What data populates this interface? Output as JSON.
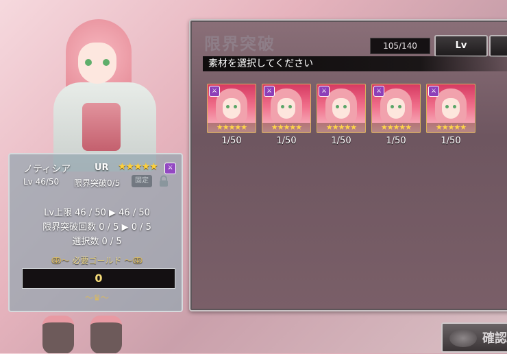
{
  "screen": {
    "title": "限界突破",
    "instruction": "素材を選択してください"
  },
  "inventory": {
    "count": "105/140"
  },
  "sort_button": {
    "label": "Lv"
  },
  "materials": [
    {
      "level": "1/50",
      "stars": "★★★★★"
    },
    {
      "level": "1/50",
      "stars": "★★★★★"
    },
    {
      "level": "1/50",
      "stars": "★★★★★"
    },
    {
      "level": "1/50",
      "stars": "★★★★★"
    },
    {
      "level": "1/50",
      "stars": "★★★★★"
    }
  ],
  "character": {
    "name": "ノティシア",
    "rarity": "UR",
    "stars": "★★★★★",
    "level": "Lv 46/50",
    "limit_break": "限界突破0/5",
    "lock_badge": "固定"
  },
  "stats": {
    "lv_cap": "Lv上限 46 / 50 ▶ 46 / 50",
    "limit_count": "限界突破回数 0 / 5 ▶ 0 / 5",
    "selected": "選択数 0 / 5"
  },
  "gold": {
    "label": "必要ゴールド",
    "value": "0"
  },
  "confirm_button": {
    "label": "確認"
  },
  "colors": {
    "panel_bg": "#6e5660",
    "info_panel_bg": "#94a6b0",
    "gold_text": "#f6dc79",
    "attribute_purple": "#9348c2"
  }
}
